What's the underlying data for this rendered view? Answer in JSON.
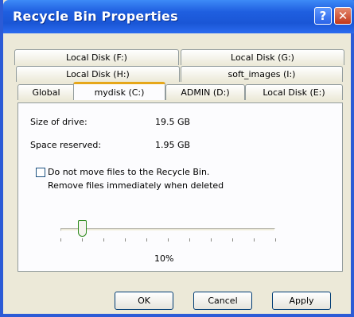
{
  "window": {
    "title": "Recycle Bin Properties",
    "help_glyph": "?",
    "close_glyph": "✕"
  },
  "tabs": {
    "row1": [
      "Local Disk (F:)",
      "Local Disk (G:)"
    ],
    "row2": [
      "Local Disk (H:)",
      "soft_images (I:)"
    ],
    "row3": [
      "Global",
      "mydisk (C:)",
      "ADMIN (D:)",
      "Local Disk (E:)"
    ],
    "selected": "mydisk (C:)"
  },
  "drive": {
    "size_label": "Size of drive:",
    "size_value": "19.5 GB",
    "reserved_label": "Space reserved:",
    "reserved_value": "1.95 GB"
  },
  "option": {
    "checked": false,
    "line1": "Do not move files to the Recycle Bin.",
    "line2": "Remove files immediately when deleted"
  },
  "slider": {
    "percent_label": "10%",
    "value_fraction": 0.1
  },
  "buttons": {
    "ok": "OK",
    "cancel": "Cancel",
    "apply": "Apply"
  }
}
